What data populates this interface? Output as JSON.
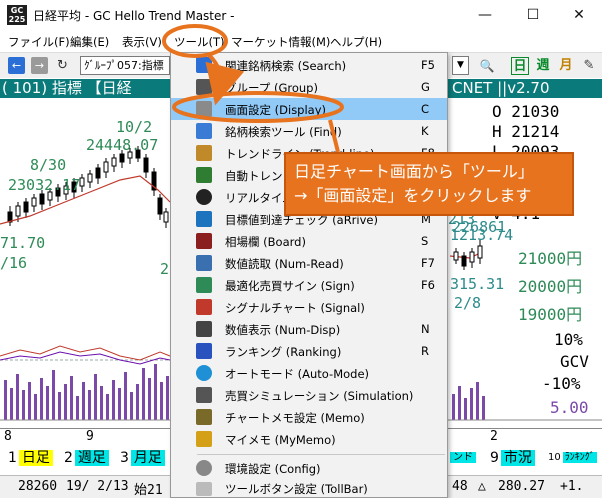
{
  "window": {
    "icon_top": "GC",
    "icon_bottom": "225",
    "title": "日経平均 - GC Hello Trend Master -",
    "minimize": "—",
    "maximize": "☐",
    "close": "✕"
  },
  "menubar": {
    "items": [
      {
        "label": "ファイル(F)"
      },
      {
        "label": "編集(E)"
      },
      {
        "label": "表示(V)"
      },
      {
        "label": "ツール(T)"
      },
      {
        "label": "マーケット情報(M)"
      },
      {
        "label": "ヘルプ(H)"
      }
    ]
  },
  "toolbar": {
    "back": "←",
    "forward": "→",
    "refresh": "↻",
    "group_value": "ｸﾞﾙｰﾌﾟ057:指標",
    "dropdown": "▼",
    "search": "🔍",
    "daily": "日",
    "weekly": "週",
    "monthly": "月",
    "edit": "✎"
  },
  "chart_header": {
    "left": "(  101)  指標 【日経",
    "right": "CNET ||v2.70"
  },
  "chart": {
    "ohlc": {
      "open": "O 21030",
      "high": "H 21214",
      "low": "L 20093",
      "close": "C 2",
      "v": "V  4.1"
    },
    "labels_left": {
      "peak_date": "10/2",
      "peak_value": "24448.07",
      "date_830": "8/30",
      "value_830": "23032.17",
      "value_left": "71.70",
      "date_left": "/16",
      "partial_2": "2"
    },
    "labels_right": {
      "r1": "213",
      "r2": "226861",
      "r3": "1213.74",
      "r4": "315.31",
      "r5": "2/8"
    },
    "price_scale": [
      "21000円",
      "20000円",
      "19000円"
    ],
    "indicator_scale": {
      "top": "10%",
      "label": "GCV",
      "bottom": "-10%",
      "value": "5.00"
    }
  },
  "axis": {
    "ticks": [
      "8",
      "9",
      "2"
    ]
  },
  "tabs": [
    {
      "num": "1",
      "label": "日足"
    },
    {
      "num": "2",
      "label": "週足"
    },
    {
      "num": "3",
      "label": "月足"
    },
    {
      "num": "",
      "label": "ンド"
    },
    {
      "num": "9",
      "label": "市況"
    },
    {
      "num": "10",
      "label": "ﾗﾝｷﾝｸﾞ"
    }
  ],
  "statusbar": {
    "c1": "28260",
    "c2": "19/ 2/13",
    "c3": "始21",
    "c4": "48",
    "c5": "△",
    "c6": "280.27",
    "c7": "+1."
  },
  "tools_menu": {
    "items": [
      {
        "label": "関連銘柄検索 (Search)",
        "key": "F5",
        "color": "#2b6fd6"
      },
      {
        "label": "グループ (Group)",
        "key": "G",
        "color": "#555555"
      },
      {
        "label": "画面設定 (Display)",
        "key": "C",
        "color": "#8a8a8a"
      },
      {
        "label": "銘柄検索ツール (Find)",
        "key": "K",
        "color": "#3a7bd5"
      },
      {
        "label": "トレンドライン (Trend-line)",
        "key": "F8",
        "color": "#c08a2a"
      },
      {
        "label": "自動トレンドライン",
        "key": "",
        "color": "#2e7d32"
      },
      {
        "label": "リアルタイム株価",
        "key": "",
        "color": "#222222"
      },
      {
        "label": "目標値到達チェック (aRrive)",
        "key": "M",
        "color": "#1e73be"
      },
      {
        "label": "相場欄 (Board)",
        "key": "S",
        "color": "#8b1e1e"
      },
      {
        "label": "数値読取 (Num-Read)",
        "key": "F7",
        "color": "#3a6fb0"
      },
      {
        "label": "最適化売買サイン (Sign)",
        "key": "F6",
        "color": "#2e8b57"
      },
      {
        "label": "シグナルチャート (Signal)",
        "key": "",
        "color": "#c0392b"
      },
      {
        "label": "数値表示 (Num-Disp)",
        "key": "N",
        "color": "#444444"
      },
      {
        "label": "ランキング (Ranking)",
        "key": "R",
        "color": "#2a52be"
      },
      {
        "label": "オートモード (Auto-Mode)",
        "key": "",
        "color": "#1f8fd6"
      },
      {
        "label": "売買シミュレーション (Simulation)",
        "key": "",
        "color": "#555555"
      },
      {
        "label": "チャートメモ設定 (Memo)",
        "key": "",
        "color": "#7a6a2a"
      },
      {
        "label": "マイメモ (MyMemo)",
        "key": "",
        "color": "#d4a017"
      },
      {
        "label": "環境設定 (Config)",
        "key": "",
        "color": "#888888"
      },
      {
        "label": "ツールボタン設定 (TollBar)",
        "key": "",
        "color": "#bbbbbb"
      }
    ]
  },
  "callout": {
    "line1": "日足チャート画面から「ツール」",
    "line2": "→「画面設定」をクリックします"
  },
  "colors": {
    "accent": "#e8731e",
    "highlight": "#91c9f7",
    "header": "#0b7a7a",
    "tab_yellow": "#ffff00",
    "tab_cyan": "#00e5e5"
  }
}
